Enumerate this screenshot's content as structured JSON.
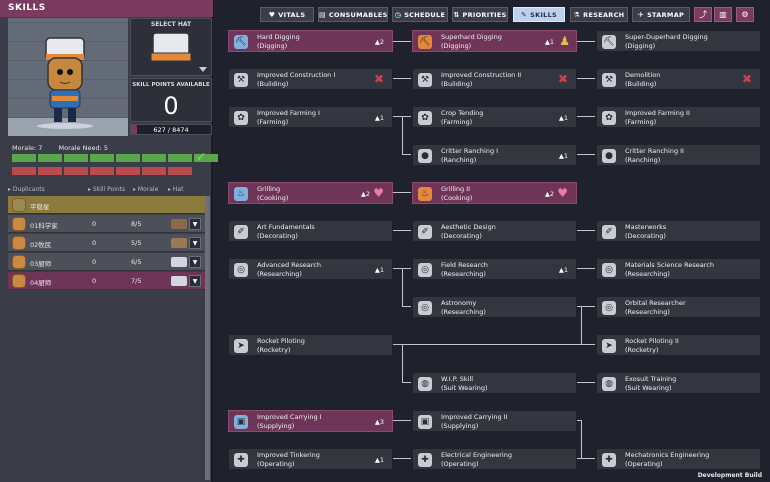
{
  "window": {
    "title": "SKILLS",
    "dev_label": "Development Build"
  },
  "hat_panel": {
    "label": "SELECT HAT"
  },
  "skill_points": {
    "label": "SKILL POINTS AVAILABLE",
    "value": "0"
  },
  "experience": {
    "text": "627 / 8474",
    "fraction": 0.074
  },
  "morale": {
    "morale_label": "Morale: 7",
    "need_label": "Morale Need: 5",
    "filled_green": 8,
    "filled_red": 7
  },
  "duplicants": {
    "headers": [
      "Duplicants",
      "Skill Points",
      "Morale",
      "Hat"
    ],
    "group": "平稳星",
    "rows": [
      {
        "name": "01科学家",
        "points": "0",
        "morale": "8/5"
      },
      {
        "name": "02牧民",
        "points": "0",
        "morale": "5/5"
      },
      {
        "name": "03厨师",
        "points": "0",
        "morale": "6/5"
      },
      {
        "name": "04厨师",
        "points": "0",
        "morale": "7/5"
      }
    ]
  },
  "tabs": [
    {
      "label": "VITALS",
      "icon": "♥"
    },
    {
      "label": "CONSUMABLES",
      "icon": "▤"
    },
    {
      "label": "SCHEDULE",
      "icon": "◷"
    },
    {
      "label": "PRIORITIES",
      "icon": "⇅"
    },
    {
      "label": "SKILLS",
      "icon": "✎"
    },
    {
      "label": "RESEARCH",
      "icon": "⚗"
    },
    {
      "label": "STARMAP",
      "icon": "✈"
    }
  ],
  "skills": [
    {
      "name": "Hard Digging",
      "group": "(Digging)",
      "count": "2"
    },
    {
      "name": "Superhard Digging",
      "group": "(Digging)",
      "count": "1"
    },
    {
      "name": "Super-Duperhard Digging",
      "group": "(Digging)"
    },
    {
      "name": "Improved Construction I",
      "group": "(Building)"
    },
    {
      "name": "Improved Construction II",
      "group": "(Building)"
    },
    {
      "name": "Demolition",
      "group": "(Building)"
    },
    {
      "name": "Improved Farming I",
      "group": "(Farming)",
      "count": "1"
    },
    {
      "name": "Crop Tending",
      "group": "(Farming)",
      "count": "1"
    },
    {
      "name": "Improved Farming II",
      "group": "(Farming)"
    },
    {
      "name": "Critter Ranching I",
      "group": "(Ranching)",
      "count": "1"
    },
    {
      "name": "Critter Ranching II",
      "group": "(Ranching)"
    },
    {
      "name": "Grilling",
      "group": "(Cooking)",
      "count": "2"
    },
    {
      "name": "Grilling II",
      "group": "(Cooking)",
      "count": "2"
    },
    {
      "name": "Art Fundamentals",
      "group": "(Decorating)"
    },
    {
      "name": "Aesthetic Design",
      "group": "(Decorating)"
    },
    {
      "name": "Masterworks",
      "group": "(Decorating)"
    },
    {
      "name": "Advanced Research",
      "group": "(Researching)",
      "count": "1"
    },
    {
      "name": "Field Research",
      "group": "(Researching)",
      "count": "1"
    },
    {
      "name": "Materials Science Research",
      "group": "(Researching)"
    },
    {
      "name": "Astronomy",
      "group": "(Researching)"
    },
    {
      "name": "Orbital Researcher",
      "group": "(Researching)"
    },
    {
      "name": "Rocket Piloting",
      "group": "(Rocketry)"
    },
    {
      "name": "Rocket Piloting II",
      "group": "(Rocketry)"
    },
    {
      "name": "W.I.P. Skill",
      "group": "(Suit Wearing)"
    },
    {
      "name": "Exosuit Training",
      "group": "(Suit Wearing)"
    },
    {
      "name": "Improved Carrying I",
      "group": "(Supplying)",
      "count": "3"
    },
    {
      "name": "Improved Carrying II",
      "group": "(Supplying)"
    },
    {
      "name": "Improved Tinkering",
      "group": "(Operating)",
      "count": "1"
    },
    {
      "name": "Electrical Engineering",
      "group": "(Operating)"
    },
    {
      "name": "Mechatronics Engineering",
      "group": "(Operating)"
    }
  ],
  "colors": {
    "owned": "#6e3558",
    "title_bar": "#7b3a5f",
    "active_tab": "#bcd1ee",
    "morale_green": "#5aa64b",
    "morale_red": "#b84c4c"
  }
}
